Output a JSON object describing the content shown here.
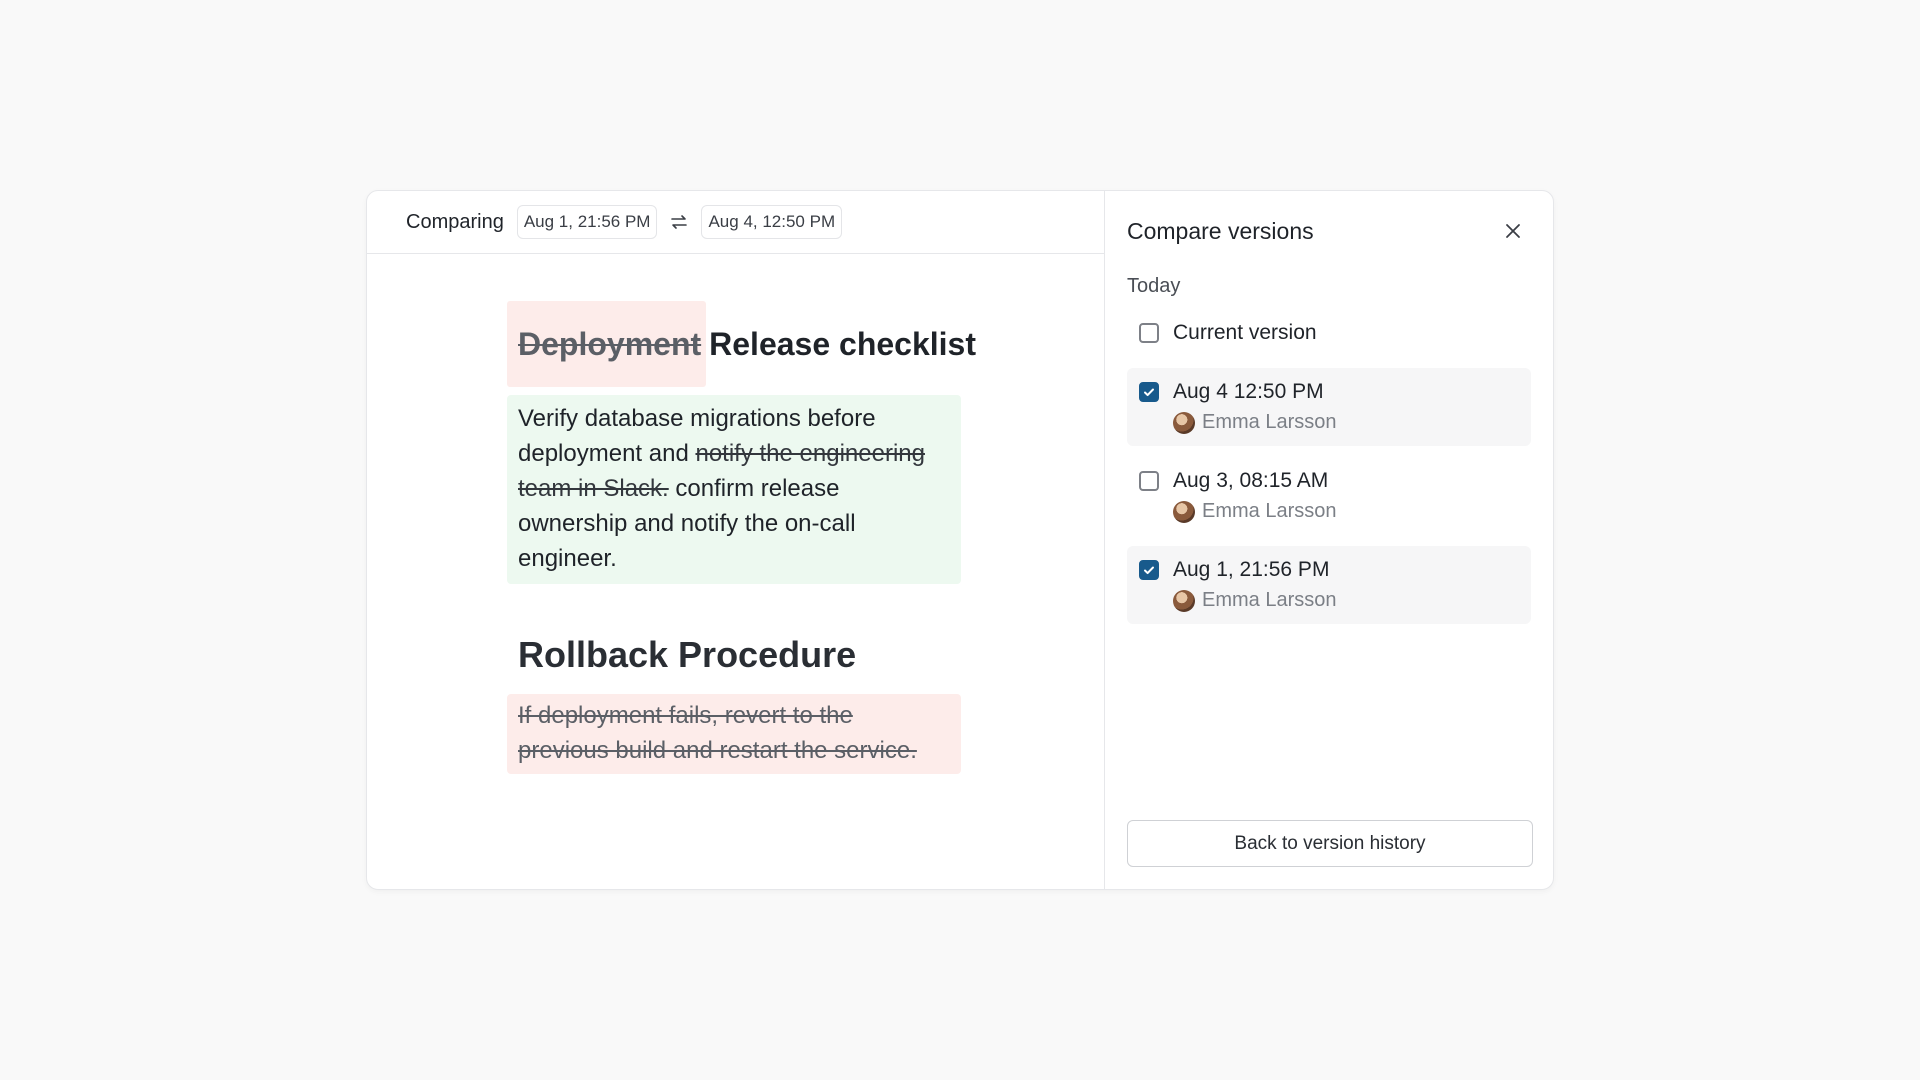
{
  "compare_bar": {
    "label": "Comparing",
    "from_date": "Aug 1, 21:56 PM",
    "to_date": "Aug 4, 12:50 PM",
    "swap_icon": "swap-arrows-icon"
  },
  "document": {
    "title_deleted": "Deployment",
    "title_inserted": "Release checklist",
    "para1_before": "Verify database migrations before deployment and ",
    "para1_deleted": "notify the engineering team in Slack.",
    "para1_after": " confirm release ownership and notify the on-call engineer.",
    "heading2": "Rollback Procedure",
    "para2_deleted": "If deployment fails, revert to the previous build and restart the service."
  },
  "side_panel": {
    "title": "Compare versions",
    "close_icon": "close-icon",
    "group_label": "Today",
    "current_version_label": "Current version",
    "versions": [
      {
        "label": "Aug 4 12:50 PM",
        "author": "Emma Larsson",
        "checked": true
      },
      {
        "label": "Aug 3, 08:15 AM",
        "author": "Emma Larsson",
        "checked": false
      },
      {
        "label": "Aug 1, 21:56 PM",
        "author": "Emma Larsson",
        "checked": true
      }
    ],
    "back_button": "Back to version history"
  },
  "colors": {
    "insert_bg": "#edf9f0",
    "delete_bg": "#fdecea",
    "checkbox_accent": "#185a8c"
  }
}
